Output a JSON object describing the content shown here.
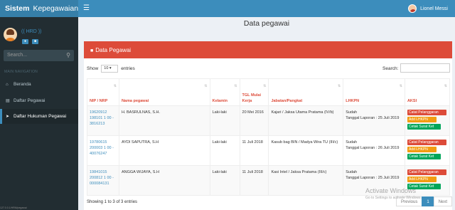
{
  "brand": {
    "bold": "Sistem",
    "rest": "Kepegawaian"
  },
  "topbar": {
    "menu_icon": "hamburger-icon",
    "user_name": "Lionel Messi"
  },
  "sidebar": {
    "role": "(( HRD ))",
    "search_placeholder": "Search...",
    "nav_header": "MAIN NAVIGATION",
    "items": [
      {
        "label": "Beranda",
        "icon": "home-icon"
      },
      {
        "label": "Daftar Pegawai",
        "icon": "book-icon"
      },
      {
        "label": "Daftar Hukuman Pegawai",
        "icon": "pin-icon"
      }
    ]
  },
  "page": {
    "title": "Data pegawai"
  },
  "box": {
    "title": "Data Pegawai",
    "show_label": "Show",
    "entries_value": "10",
    "entries_label": "entries",
    "search_label": "Search:"
  },
  "table": {
    "headers": [
      "NIP / NRP",
      "Nama pegawai",
      "Kelamin",
      "TGL Mulai Kerja",
      "Jabatan/Pangkat",
      "LHKPN",
      "AKSI"
    ],
    "rows": [
      {
        "nip": "19620912 198101 1 00 - 3816213",
        "nama": "H. BASRULNAS, S.H.",
        "kelamin": "Laki-laki",
        "tgl": "20 Mei 2016",
        "jabatan": "Kajari / Jaksa Utama Pratama (IV/b)",
        "lhkpn1": "Sudah",
        "lhkpn2": "Tanggal Laporan : 25 Juli 2019"
      },
      {
        "nip": "19780615 200003 1 00 - 40076247",
        "nama": "AYDI SAPUTRA, S.H",
        "kelamin": "Laki-laki",
        "tgl": "11 Juli 2018",
        "jabatan": "Kasub bag BIN / Madya Wira TU (III/c)",
        "lhkpn1": "Sudah",
        "lhkpn2": "Tanggal Laporan : 26 Juli 2019"
      },
      {
        "nip": "19841015 200812 1 00 - 000084131",
        "nama": "ANGGA WIJAYA, S.H",
        "kelamin": "Laki-laki",
        "tgl": "11 Juli 2018",
        "jabatan": "Kasi Intel / Jaksa Pratama (III/c)",
        "lhkpn1": "Sudah",
        "lhkpn2": "Tanggal Laporan : 25 Juli 2019"
      }
    ],
    "actions": {
      "catat": "Catat Pelanggaran",
      "lhkpn": "Add LHKPN",
      "cetak": "Cetak Surat Ket"
    }
  },
  "footer": {
    "info": "Showing 1 to 3 of 3 entries",
    "prev": "Previous",
    "page": "1",
    "next": "Next"
  },
  "watermark": {
    "line1": "Activate Windows",
    "line2": "Go to Settings to activate Windows."
  },
  "statusbar": "127.0.0.1/HRM/pegawai"
}
